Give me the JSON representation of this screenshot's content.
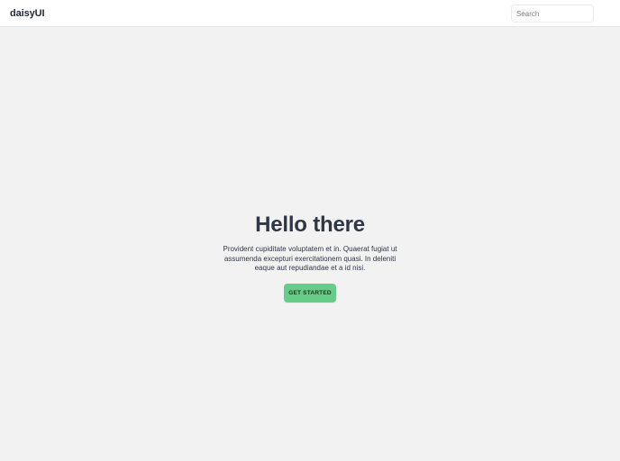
{
  "navbar": {
    "brand": "daisyUI",
    "search_placeholder": "Search"
  },
  "hero": {
    "title": "Hello there",
    "text": "Provident cupiditate voluptatem et in. Quaerat fugiat ut assumenda excepturi exercitationem quasi. In deleniti eaque aut repudiandae et a id nisi.",
    "button_label": "Get Started"
  },
  "colors": {
    "primary": "#66cc8a",
    "base_100": "#ffffff",
    "base_200": "#f2f2f2",
    "base_content": "#333c4d"
  }
}
